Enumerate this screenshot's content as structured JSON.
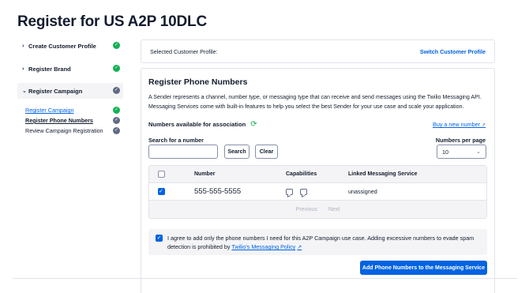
{
  "page": {
    "title": "Register for US A2P 10DLC"
  },
  "sidebar": {
    "steps": [
      {
        "label": "Create Customer Profile",
        "status": "complete"
      },
      {
        "label": "Register Brand",
        "status": "complete"
      },
      {
        "label": "Register Campaign",
        "status": "in-progress"
      }
    ],
    "substeps": [
      {
        "label": "Register Campaign",
        "status": "complete"
      },
      {
        "label": "Register Phone Numbers",
        "status": "current"
      },
      {
        "label": "Review Campaign Registration",
        "status": "pending"
      }
    ]
  },
  "profile": {
    "label": "Selected Customer Profile:",
    "switch_label": "Switch Customer Profile"
  },
  "card": {
    "title": "Register Phone Numbers",
    "description": "A Sender represents a channel, number type, or messaging type that can receive and send messages using the Twilio Messaging API. Messaging Services come with built-in features to help you select the best Sender for your use case and scale your application.",
    "available_label": "Numbers available for association",
    "buy_link": "Buy a new number",
    "search": {
      "label": "Search for a number",
      "value": "",
      "placeholder": "",
      "search_button": "Search",
      "clear_button": "Clear"
    },
    "per_page": {
      "label": "Numbers per page",
      "value": "10"
    },
    "table": {
      "headers": [
        "Number",
        "Capabilities",
        "Linked Messaging Service"
      ],
      "rows": [
        {
          "number": "555-555-5555",
          "capabilities": [
            "sms-icon",
            "mms-icon"
          ],
          "service": "unassigned",
          "checked": true
        }
      ],
      "pager": {
        "previous": "Previous",
        "next": "Next"
      }
    },
    "agreement": {
      "text": "I agree to add only the phone numbers I need for this A2P Campaign use case. Adding excessive numbers to evade spam detection is prohibited by",
      "policy_link": "Twilio's Messaging Policy",
      "checked": true
    },
    "submit_label": "Add Phone Numbers to the Messaging Service"
  },
  "colors": {
    "accent": "#0263e0",
    "success": "#14b053",
    "muted": "#606b85"
  }
}
